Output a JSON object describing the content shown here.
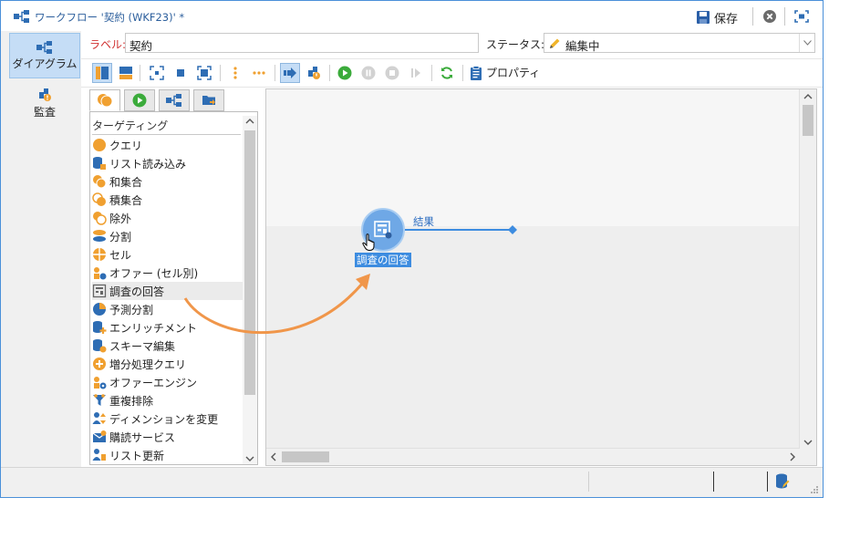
{
  "window": {
    "title": "ワークフロー '契約 (WKF23)' *",
    "save_label": "保存",
    "icons": [
      "workflow-icon",
      "save-disk-icon",
      "close-circle-icon",
      "fit-screen-icon"
    ]
  },
  "left_nav": {
    "items": [
      {
        "label": "ダイアグラム",
        "icon": "diagram-icon",
        "active": true
      },
      {
        "label": "監査",
        "icon": "audit-icon",
        "active": false
      }
    ]
  },
  "header": {
    "label_caption": "ラベル:",
    "label_value": "契約",
    "status_caption": "ステータス:",
    "status_value": "編集中"
  },
  "toolbar": {
    "properties_label": "プロパティ"
  },
  "palette": {
    "category": "ターゲティング",
    "items": [
      {
        "label": "クエリ",
        "icon": "query-icon"
      },
      {
        "label": "リスト読み込み",
        "icon": "list-read-icon"
      },
      {
        "label": "和集合",
        "icon": "union-icon"
      },
      {
        "label": "積集合",
        "icon": "intersection-icon"
      },
      {
        "label": "除外",
        "icon": "exclusion-icon"
      },
      {
        "label": "分割",
        "icon": "split-icon"
      },
      {
        "label": "セル",
        "icon": "cell-icon"
      },
      {
        "label": "オファー (セル別)",
        "icon": "offer-by-cell-icon"
      },
      {
        "label": "調査の回答",
        "icon": "survey-response-icon"
      },
      {
        "label": "予測分割",
        "icon": "predictive-split-icon"
      },
      {
        "label": "エンリッチメント",
        "icon": "enrichment-icon"
      },
      {
        "label": "スキーマ編集",
        "icon": "schema-edit-icon"
      },
      {
        "label": "増分処理クエリ",
        "icon": "incremental-query-icon"
      },
      {
        "label": "オファーエンジン",
        "icon": "offer-engine-icon"
      },
      {
        "label": "重複排除",
        "icon": "deduplication-icon"
      },
      {
        "label": "ディメンションを変更",
        "icon": "change-dimension-icon"
      },
      {
        "label": "購読サービス",
        "icon": "subscription-services-icon"
      },
      {
        "label": "リスト更新",
        "icon": "list-update-icon"
      }
    ],
    "hovered_index": 8
  },
  "canvas": {
    "node_label": "調査の回答",
    "transition_label": "結果"
  },
  "colors": {
    "accent_blue": "#3d8ce0",
    "activity_orange": "#f0a030",
    "run_green": "#3bab3b",
    "drag_arrow": "#f0964a"
  }
}
